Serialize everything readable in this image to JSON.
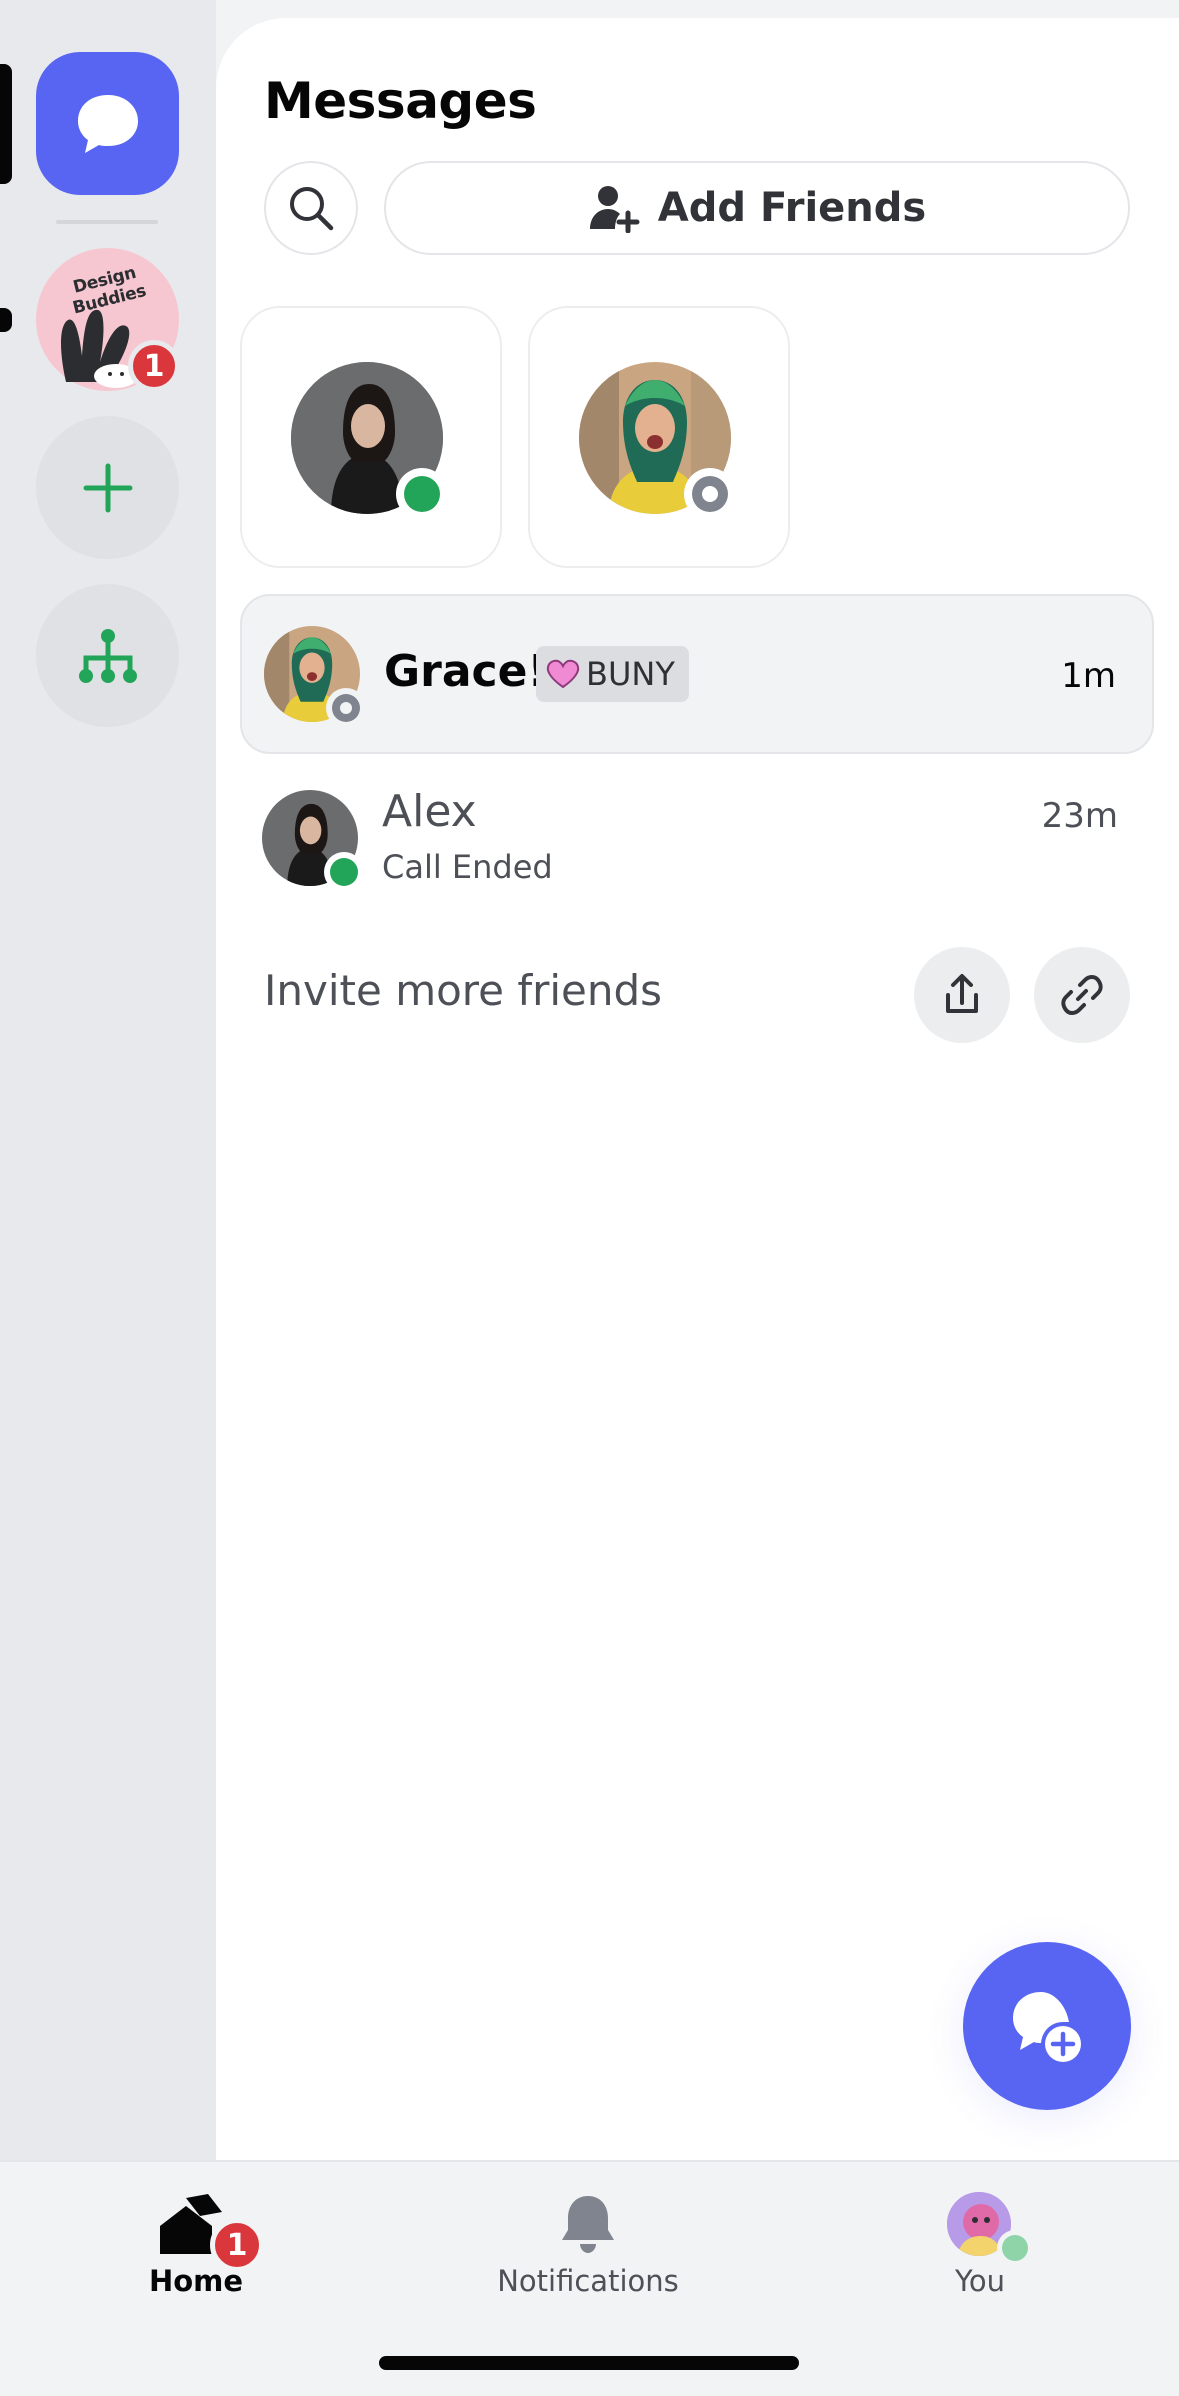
{
  "rail": {
    "server": {
      "name": "Design Buddies",
      "badge": "1"
    }
  },
  "main": {
    "title": "Messages",
    "add_friends_label": "Add Friends",
    "dms": [
      {
        "name": "Grace!",
        "tag": "BUNY",
        "time": "1m",
        "status": "idle"
      },
      {
        "name": "Alex",
        "subtitle": "Call Ended",
        "time": "23m",
        "status": "online"
      }
    ],
    "invite_label": "Invite more friends"
  },
  "tabs": [
    {
      "label": "Home",
      "badge": "1",
      "active": true
    },
    {
      "label": "Notifications",
      "active": false
    },
    {
      "label": "You",
      "active": false
    }
  ],
  "colors": {
    "accent": "#5865f2",
    "online": "#23a559",
    "idle": "#80848e",
    "badge": "#da373c"
  }
}
